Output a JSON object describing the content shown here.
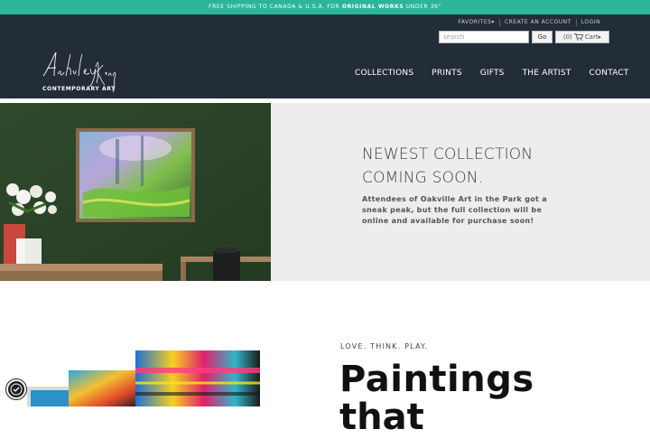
{
  "promo": {
    "prefix": "FREE SHIPPING TO CANADA & U.S.A. FOR ",
    "highlight": "ORIGINAL WORKS",
    "suffix": " UNDER 36\""
  },
  "util_links": [
    "FAVORITES▾",
    "CREATE AN ACCOUNT",
    "LOGIN"
  ],
  "search": {
    "placeholder": "search",
    "go_label": "Go"
  },
  "cart": {
    "count": "(0)",
    "label": "Cart▸"
  },
  "logo": {
    "script": "Ashley King",
    "subtitle": "CONTEMPORARY ART"
  },
  "nav": [
    "COLLECTIONS",
    "PRINTS",
    "GIFTS",
    "THE ARTIST",
    "CONTACT"
  ],
  "hero": {
    "title_line1": "NEWEST COLLECTION",
    "title_line2": "COMING SOON.",
    "text": "Attendees of Oakville Art in the Park got a sneak peak, but the full collection will be online and available for purchase soon!"
  },
  "section": {
    "tagline": "LOVE. THINK. PLAY.",
    "heading": "Paintings",
    "heading_2": "that"
  },
  "colors": {
    "promo_bg": "#2bb59a",
    "header_bg": "#232d38",
    "wall_green": "#2c4228",
    "panel_bg": "#ededed"
  }
}
